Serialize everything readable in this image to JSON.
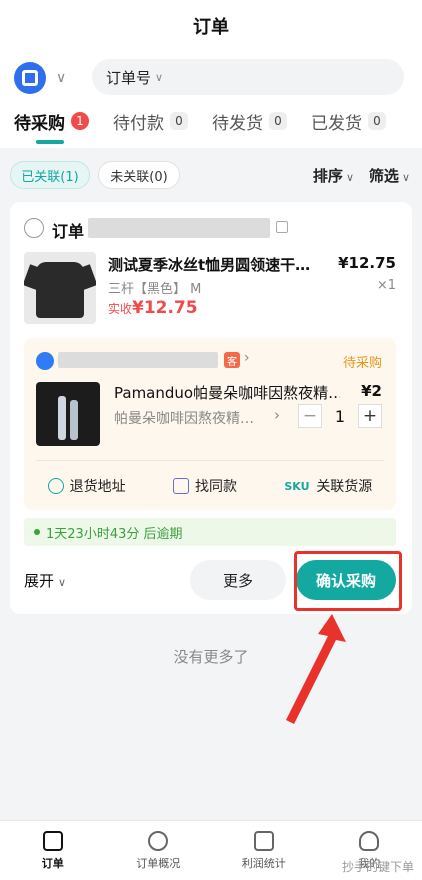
{
  "header": {
    "title": "订单"
  },
  "search": {
    "field_label": "订单号"
  },
  "tabs": [
    {
      "label": "待采购",
      "count": "1"
    },
    {
      "label": "待付款",
      "count": "0"
    },
    {
      "label": "待发货",
      "count": "0"
    },
    {
      "label": "已发货",
      "count": "0"
    }
  ],
  "filters": {
    "linked": "已关联(1)",
    "unlinked": "未关联(0)",
    "sort": "排序",
    "filter": "筛选"
  },
  "order": {
    "label": "订单",
    "product": {
      "title": "测试夏季冰丝t恤男圆领速干…",
      "price": "¥12.75",
      "spec": "三杆【黑色】 M",
      "qty": "×1",
      "actual_label": "实收",
      "actual_amount": "¥12.75"
    },
    "purchase": {
      "status": "待采购",
      "shop_tag": "客",
      "title": "Pamanduo帕曼朵咖啡因熬夜精…",
      "price": "¥2",
      "spec": "帕曼朵咖啡因熬夜精…",
      "quantity": "1",
      "minus": "−",
      "plus": "+",
      "actions": {
        "return_address": "退货地址",
        "find_same": "找同款",
        "sku_badge": "SKU",
        "link_source": "关联货源"
      }
    },
    "deadline": "1天23小时43分 后逾期",
    "expand": "展开",
    "more_button": "更多",
    "confirm_button": "确认采购"
  },
  "no_more": "没有更多了",
  "tabbar": [
    {
      "label": "订单",
      "icon": "order-icon"
    },
    {
      "label": "订单概况",
      "icon": "heart-icon"
    },
    {
      "label": "利润统计",
      "icon": "chart-icon"
    },
    {
      "label": "我的",
      "icon": "user-icon"
    }
  ],
  "watermark": "抄手的键下单",
  "colors": {
    "accent": "#13a8a0",
    "alert": "#f24a4a",
    "highlight": "#e8322b",
    "pending": "#e8961a"
  }
}
